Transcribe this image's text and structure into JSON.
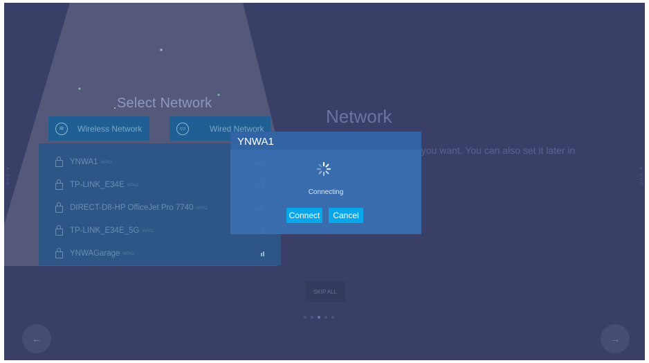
{
  "left_panel": {
    "title": "Select Network",
    "tabs": [
      {
        "label": "Wireless Network",
        "icon": "wifi-icon"
      },
      {
        "label": "Wired Network",
        "icon": "ethernet-icon"
      }
    ],
    "networks": [
      {
        "ssid": "YNWA1",
        "security": "WPA2",
        "signal_bars": 3
      },
      {
        "ssid": "TP-LINK_E34E",
        "security": "WPA2",
        "signal_bars": 4
      },
      {
        "ssid": "DIRECT-D8-HP OfficeJet Pro 7740",
        "security": "WPA2",
        "signal_bars": 3
      },
      {
        "ssid": "TP-LINK_E34E_5G",
        "security": "WPA2",
        "signal_bars": 2
      },
      {
        "ssid": "YNWAGarage",
        "security": "WPA2",
        "signal_bars": 2
      }
    ]
  },
  "right_panel": {
    "title": "Network",
    "description": "Select the connection you want. You can also set it later in the system settings."
  },
  "footer": {
    "skip_label": "SKIP ALL",
    "pager": {
      "total": 5,
      "current": 3
    },
    "prev_icon": "arrow-left-icon",
    "next_icon": "arrow-right-icon"
  },
  "dialog": {
    "title": "YNWA1",
    "status": "Connecting",
    "connect_label": "Connect",
    "cancel_label": "Cancel"
  },
  "colors": {
    "background": "#3a3f68",
    "dialog": "#3a70b2",
    "button": "#0aa6ea"
  }
}
